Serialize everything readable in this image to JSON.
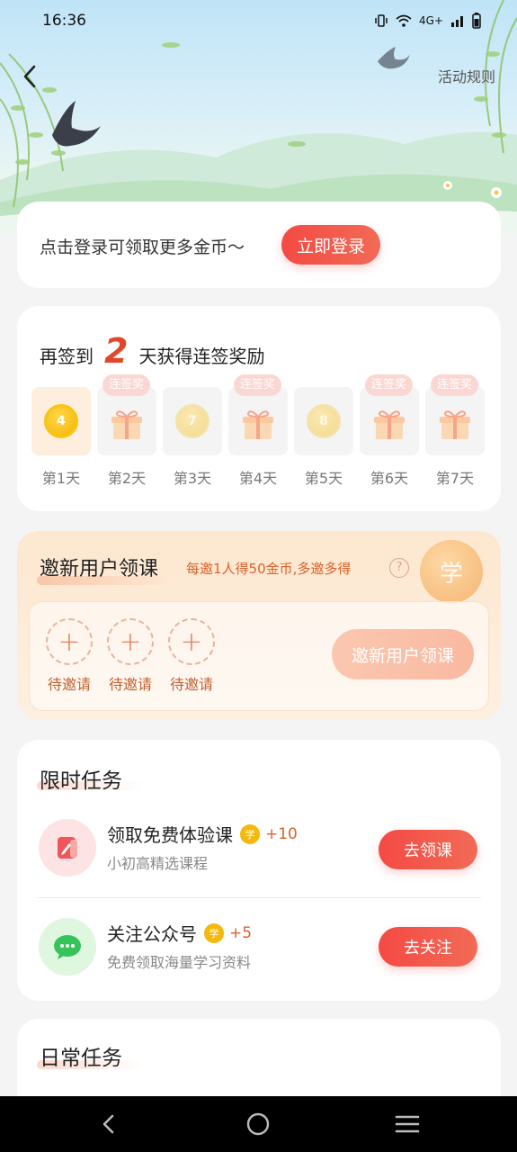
{
  "status_bar": {
    "time": "16:36",
    "network": "4G+"
  },
  "header": {
    "rules_label": "活动规则"
  },
  "login": {
    "prompt": "点击登录可领取更多金币～",
    "button": "立即登录"
  },
  "signin": {
    "prefix": "再签到",
    "remaining": "2",
    "suffix": "天获得连签奖励",
    "days": [
      {
        "label": "第1天",
        "kind": "coin",
        "value": "4",
        "current": true
      },
      {
        "label": "第2天",
        "kind": "gift",
        "tag": "连签奖"
      },
      {
        "label": "第3天",
        "kind": "coin",
        "value": "7"
      },
      {
        "label": "第4天",
        "kind": "gift",
        "tag": "连签奖"
      },
      {
        "label": "第5天",
        "kind": "coin",
        "value": "8"
      },
      {
        "label": "第6天",
        "kind": "gift",
        "tag": "连签奖"
      },
      {
        "label": "第7天",
        "kind": "gift",
        "tag": "连签奖"
      }
    ]
  },
  "invite": {
    "title": "邀新用户领课",
    "subtitle": "每邀1人得50金币,多邀多得",
    "help": "?",
    "coin_glyph": "学",
    "slots": [
      "待邀请",
      "待邀请",
      "待邀请"
    ],
    "button": "邀新用户领课"
  },
  "limited_tasks": {
    "title": "限时任务",
    "items": [
      {
        "name": "领取免费体验课",
        "coin_glyph": "学",
        "reward": "+10",
        "desc": "小初高精选课程",
        "button": "去领课",
        "icon": "pencil-book-icon"
      },
      {
        "name": "关注公众号",
        "coin_glyph": "学",
        "reward": "+5",
        "desc": "免费领取海量学习资料",
        "button": "去关注",
        "icon": "wechat-icon"
      }
    ]
  },
  "daily_tasks": {
    "title": "日常任务"
  },
  "colors": {
    "accent_red": "#f44a44",
    "orange_text": "#d9622b",
    "gold": "#f5b400"
  }
}
